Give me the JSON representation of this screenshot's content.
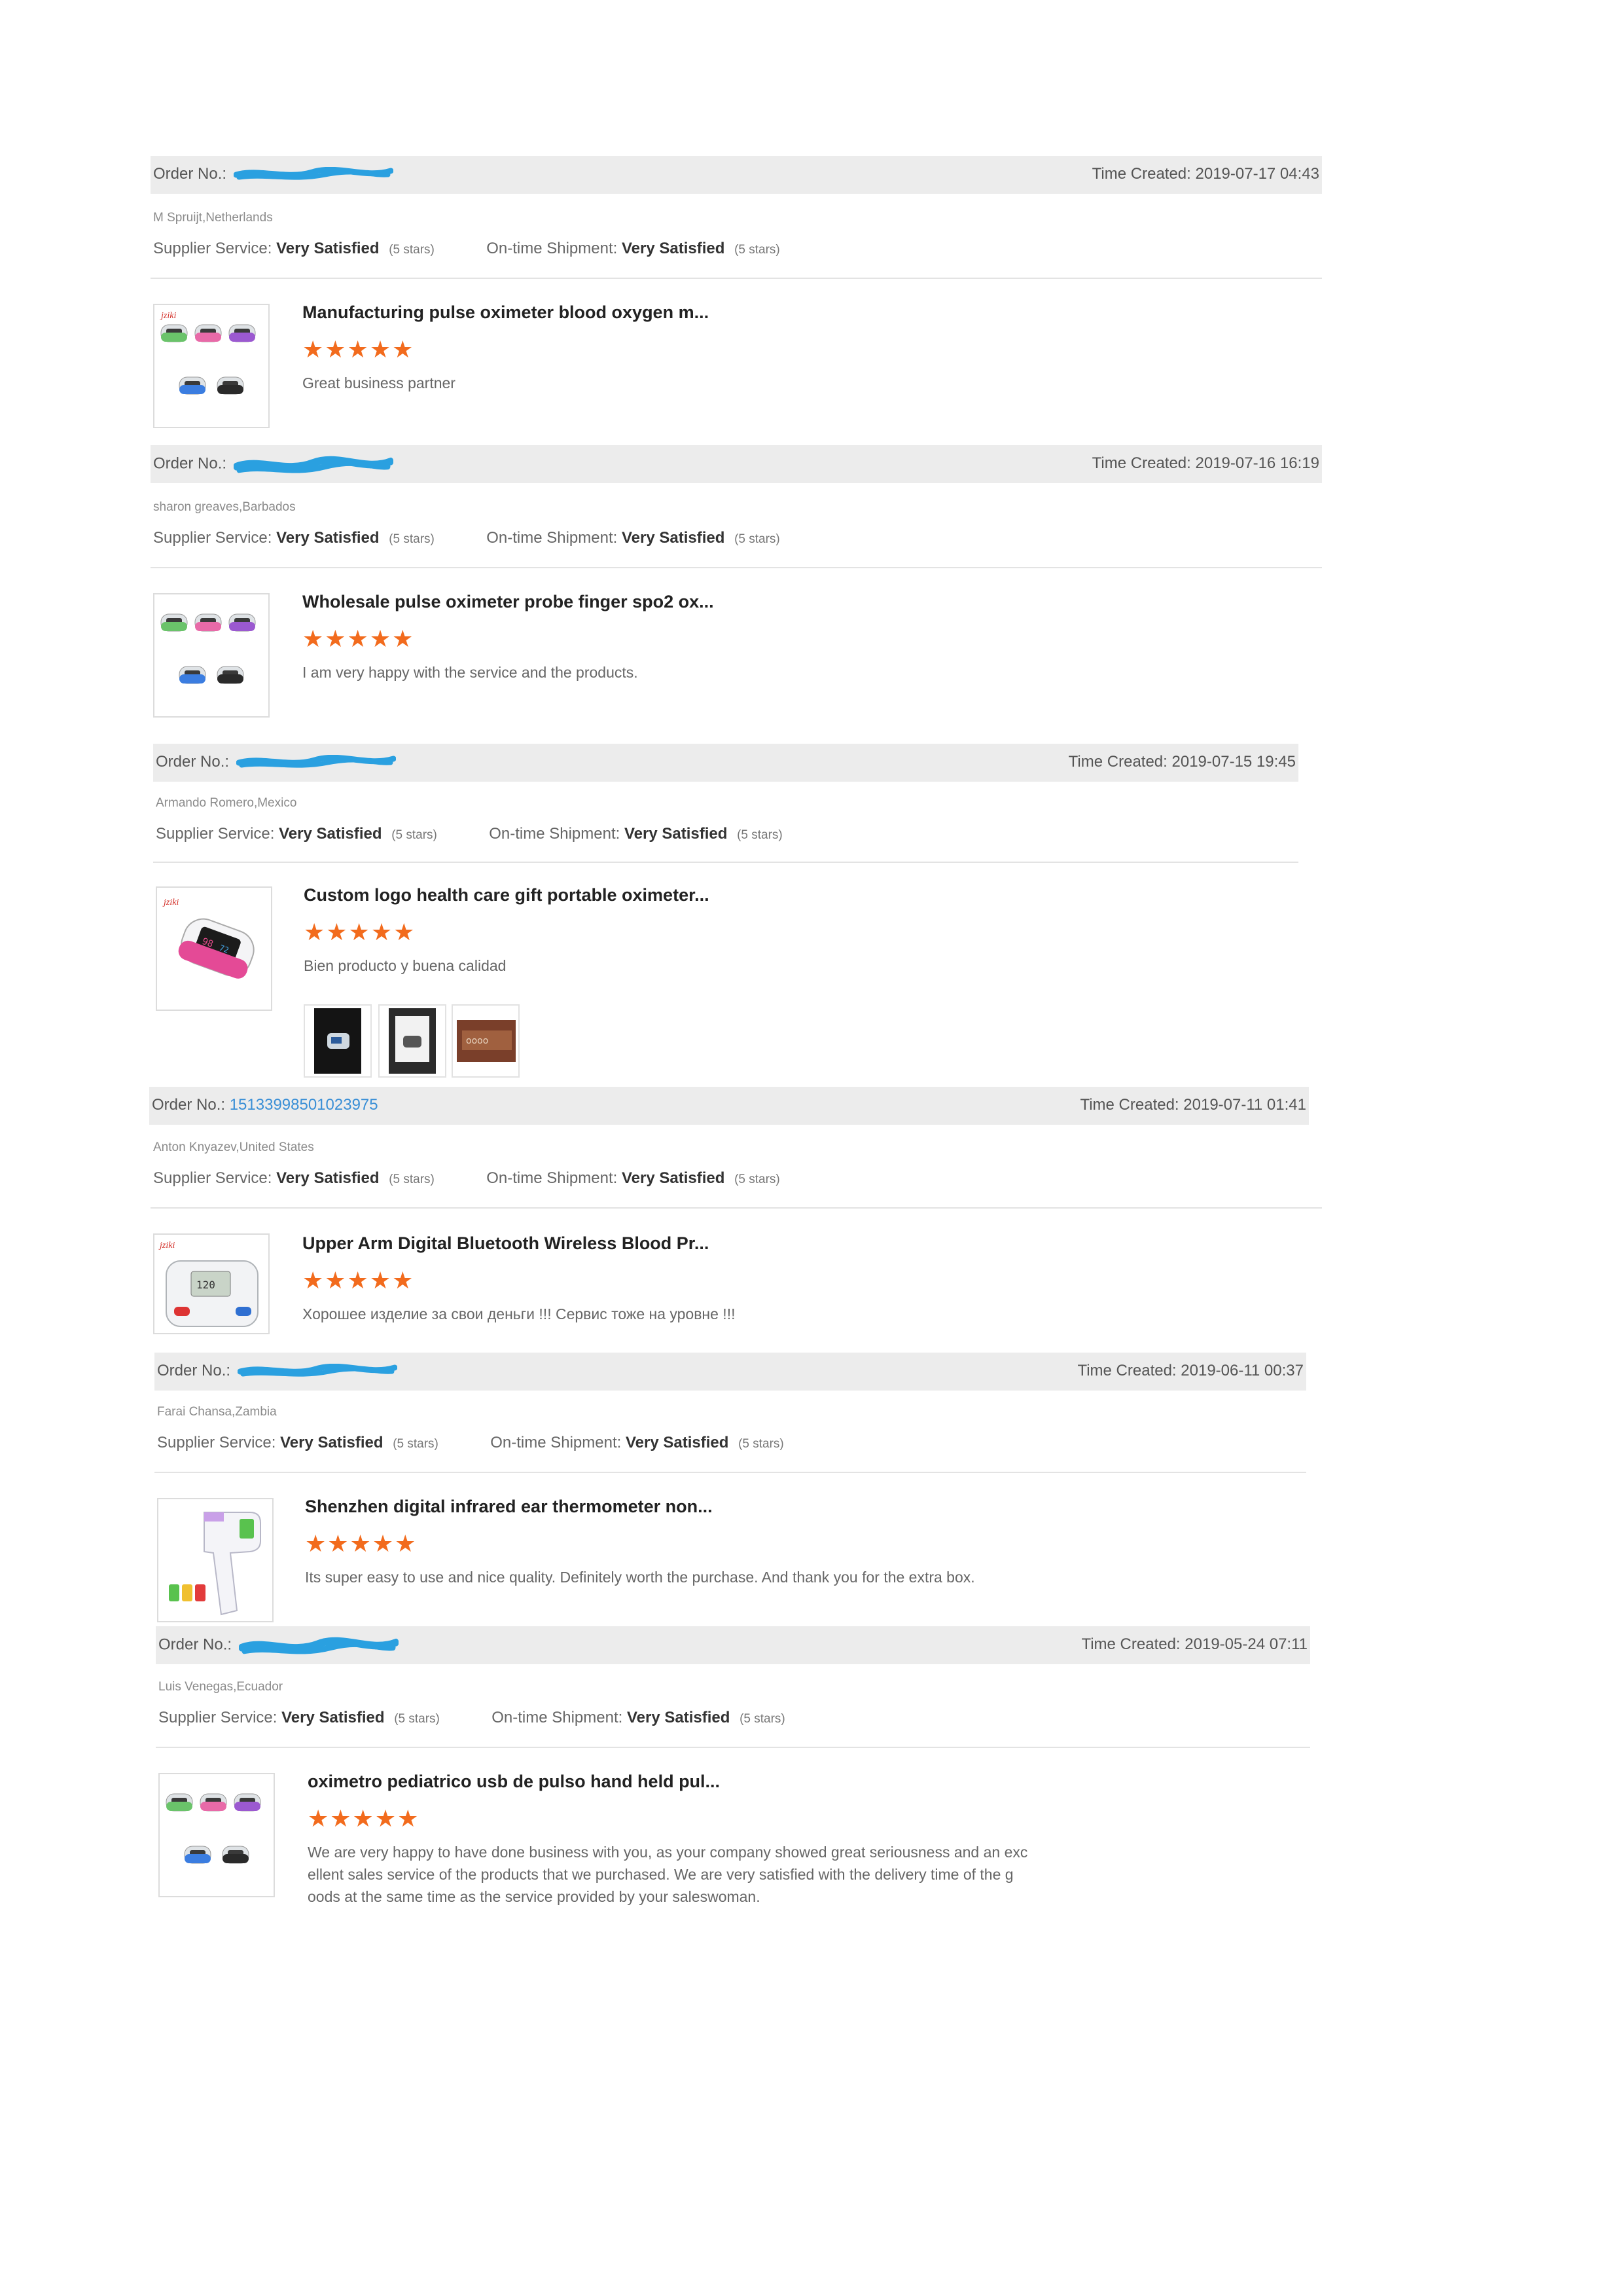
{
  "labels": {
    "order_no": "Order No.:",
    "time_created": "Time Created:",
    "supplier_service": "Supplier Service:",
    "ontime_shipment": "On-time Shipment:",
    "very_satisfied": "Very Satisfied",
    "five_stars": "(5 stars)",
    "star_glyphs": "★★★★★"
  },
  "colors": {
    "accent_star": "#f26b1d",
    "link": "#3a8fd6",
    "bar_bg": "#ececec"
  },
  "reviews": [
    {
      "order_no": "",
      "time_created": "2019-07-17 04:43",
      "buyer": "M Spruijt,Netherlands",
      "product_title": "Manufacturing pulse oximeter blood oxygen m...",
      "rating": 5,
      "comment": "Great business partner",
      "thumb_icon": "pulse-oximeter-set-icon"
    },
    {
      "order_no": "",
      "time_created": "2019-07-16 16:19",
      "buyer": "sharon greaves,Barbados",
      "product_title": "Wholesale pulse oximeter probe finger spo2 ox...",
      "rating": 5,
      "comment": "I am very happy with the service and the products.",
      "thumb_icon": "pulse-oximeter-set-icon"
    },
    {
      "order_no": "",
      "time_created": "2019-07-15 19:45",
      "buyer": "Armando Romero,Mexico",
      "product_title": "Custom logo health care gift portable oximeter...",
      "rating": 5,
      "comment": "Bien producto y buena calidad",
      "thumb_icon": "single-oximeter-icon"
    },
    {
      "order_no": "15133998501023975",
      "time_created": "2019-07-11 01:41",
      "buyer": "Anton Knyazev,United States",
      "product_title": "Upper Arm Digital Bluetooth Wireless Blood Pr...",
      "rating": 5,
      "comment": "Хорошее изделие за свои деньги !!! Сервис тоже на уровне !!!",
      "thumb_icon": "blood-pressure-monitor-icon"
    },
    {
      "order_no": "",
      "time_created": "2019-06-11 00:37",
      "buyer": "Farai Chansa,Zambia",
      "product_title": "Shenzhen digital infrared ear thermometer non...",
      "rating": 5,
      "comment": "Its super easy to use and nice quality. Definitely worth the purchase. And thank you for the extra box.",
      "thumb_icon": "infrared-thermometer-icon"
    },
    {
      "order_no": "",
      "time_created": "2019-05-24 07:11",
      "buyer": "Luis Venegas,Ecuador",
      "product_title": "oximetro pediatrico usb de pulso hand held pul...",
      "rating": 5,
      "comment_lines": [
        "We are very happy to have done business with you, as your company showed great seriousness and an exc",
        "ellent sales service of the products that we purchased. We are very satisfied with the delivery time of the g",
        "oods at the same time as the service provided by your saleswoman."
      ],
      "thumb_icon": "pulse-oximeter-set-icon"
    }
  ]
}
